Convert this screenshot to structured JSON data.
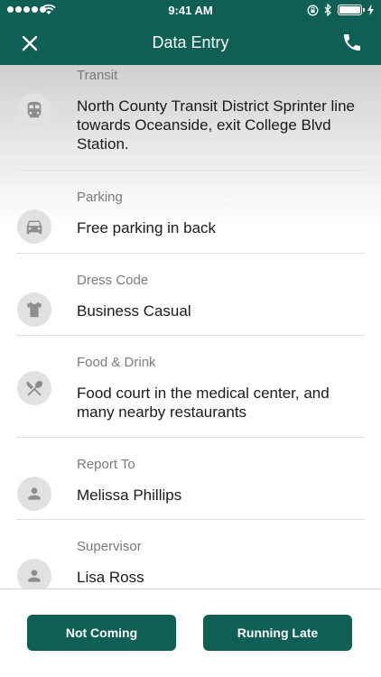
{
  "status": {
    "time": "9:41 AM"
  },
  "nav": {
    "title": "Data Entry",
    "close_icon": "close-icon",
    "phone_icon": "phone-icon"
  },
  "rows": [
    {
      "label": "Transit",
      "value": "North County Transit District Sprinter line towards Oceanside, exit College Blvd Station.",
      "icon": "train-icon"
    },
    {
      "label": "Parking",
      "value": "Free parking in back",
      "icon": "car-icon"
    },
    {
      "label": "Dress Code",
      "value": "Business Casual",
      "icon": "shirt-icon"
    },
    {
      "label": "Food & Drink",
      "value": "Food court in the medical center, and many nearby restaurants",
      "icon": "fork-knife-icon"
    },
    {
      "label": "Report To",
      "value": "Melissa Phillips",
      "icon": "person-icon"
    },
    {
      "label": "Supervisor",
      "value": "Lisa Ross",
      "icon": "person-icon"
    }
  ],
  "footer": {
    "not_coming": "Not Coming",
    "running_late": "Running Late"
  },
  "colors": {
    "brand": "#0f5f54",
    "icon_bg": "#e1e1e1",
    "icon_fg": "#8d8d8d"
  }
}
